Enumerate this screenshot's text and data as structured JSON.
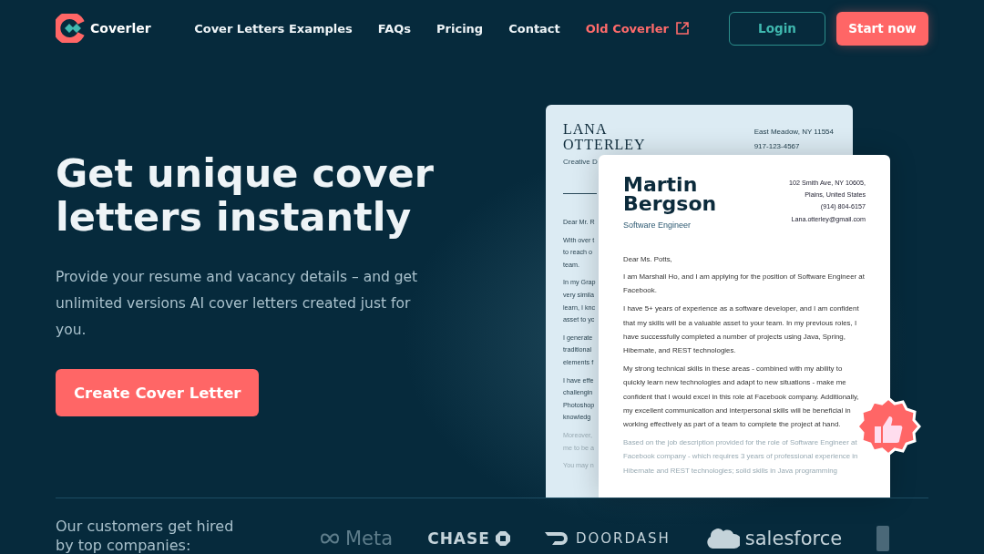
{
  "nav": {
    "logo": "Coverler",
    "links": [
      {
        "label": "Cover Letters Examples",
        "kind": "plain"
      },
      {
        "label": "FAQs",
        "kind": "plain"
      },
      {
        "label": "Pricing",
        "kind": "plain"
      },
      {
        "label": "Contact",
        "kind": "plain"
      },
      {
        "label": "Old Coverler",
        "kind": "external"
      }
    ],
    "login": "Login",
    "start": "Start now"
  },
  "hero": {
    "title": "Get unique cover letters instantly",
    "subtitle": "Provide your resume and vacancy details – and get unlimited versions AI cover letters created just for you.",
    "cta": "Create Cover Letter"
  },
  "back_letter": {
    "name_lines": [
      "LANA",
      "OTTERLEY"
    ],
    "contact": [
      "East Meadow, NY 11554",
      "917-123-4567"
    ],
    "role": "Creative D",
    "paragraphs": [
      {
        "lines": [
          "Dear Mr. R"
        ],
        "faded": false
      },
      {
        "lines": [
          "With over t",
          "to reach o",
          "team."
        ],
        "faded": false
      },
      {
        "lines": [
          "In my Grap",
          "very simila",
          "learn, I knc",
          "asset to yc"
        ],
        "faded": false
      },
      {
        "lines": [
          "I generate",
          "traditional",
          "elements f"
        ],
        "faded": false
      },
      {
        "lines": [
          "I have effe",
          "challengin",
          "Photoshop",
          "knowledg"
        ],
        "faded": false
      },
      {
        "lines": [
          "Moreover,",
          "me to be a"
        ],
        "faded": true
      },
      {
        "lines": [
          "You may n"
        ],
        "faded": true
      }
    ]
  },
  "front_letter": {
    "name_lines": [
      "Martin",
      "Bergson"
    ],
    "role": "Software Engineer",
    "contact": [
      "102 Smith Ave, NY 10605,",
      "Plains, United States",
      "(914) 804-6157",
      "Lana.otterley@gmail.com"
    ],
    "greeting": "Dear Ms. Potts,",
    "paragraphs": [
      {
        "text": "I am Marshall Ho, and I am applying for the position of Software Engineer at Facebook.",
        "faded": false
      },
      {
        "text": "I have 5+ years of experience as a software developer, and I am confident that my skills will be a valuable asset to your team. In my previous roles, I have successfully completed a number of projects using Java, Spring, Hibernate, and REST technologies.",
        "faded": false
      },
      {
        "text": "My strong technical skills in these areas - combined with my ability to quickly learn new technologies and adapt to new situations - make me confident that I would excel in this role at Facebook company. Additionally, my excellent communication and interpersonal skills will be beneficial in working effectively as part of a team to complete the project at hand.",
        "faded": false
      },
      {
        "text": "Based on the job description provided for the role of Software Engineer at Facebook company - which requires 3 years of professional experience in Hibernate and REST technologies; solid skills in Java programming",
        "faded": true
      }
    ]
  },
  "customers": {
    "caption": "Our customers get hired by top companies:",
    "logos": [
      {
        "name": "Meta",
        "kind": "meta"
      },
      {
        "name": "CHASE",
        "kind": "chase"
      },
      {
        "name": "DOORDASH",
        "kind": "doordash"
      },
      {
        "name": "salesforce",
        "kind": "salesforce"
      },
      {
        "kind": "fragment"
      }
    ]
  }
}
